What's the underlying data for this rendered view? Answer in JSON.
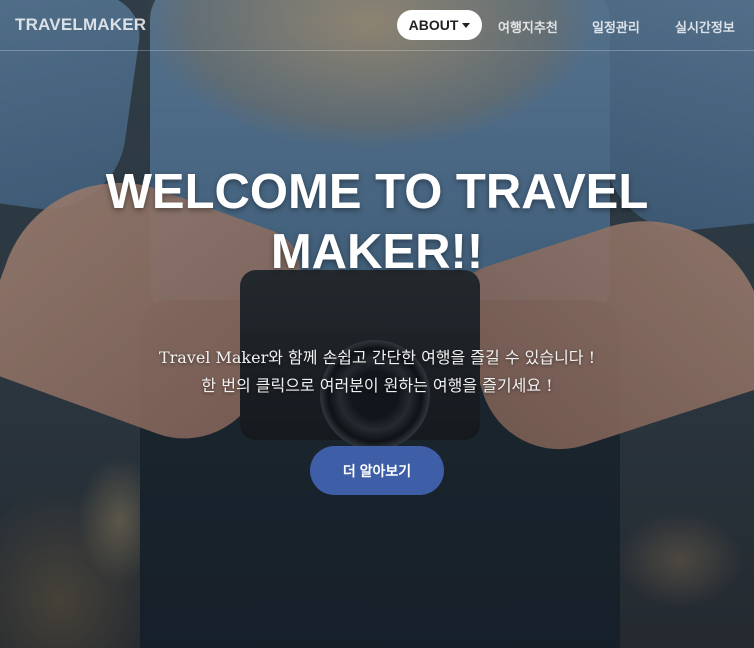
{
  "navbar": {
    "brand": "TRAVELMAKER",
    "about_label": "ABOUT",
    "items": [
      {
        "label": "여행지추천"
      },
      {
        "label": "일정관리"
      },
      {
        "label": "실시간정보"
      }
    ]
  },
  "hero": {
    "headline_line1": "WELCOME TO TRAVEL",
    "headline_line2": "MAKER!!",
    "subtitle_line1": "Travel Maker와 함께 손쉽고 간단한 여행을 즐길 수 있습니다 !",
    "subtitle_line2": "한 번의 클릭으로 여러분이 원하는 여행을 즐기세요 !",
    "cta_label": "더 알아보기"
  },
  "colors": {
    "accent": "#3f5ea8",
    "nav_pill_bg": "#ffffff"
  }
}
